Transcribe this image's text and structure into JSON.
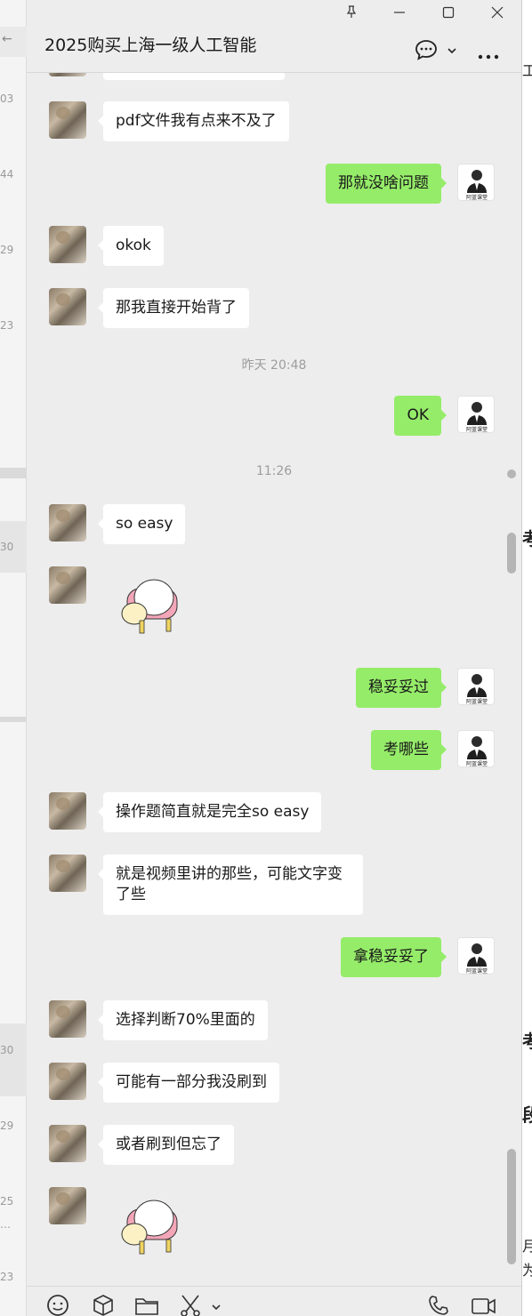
{
  "window": {
    "title": "2025购买上海一级人工智能",
    "controls": [
      "pin-icon",
      "minimize-icon",
      "maximize-icon",
      "close-icon"
    ]
  },
  "header_icons": [
    "chat-bubble-icon",
    "chevron-down-icon",
    "more-icon"
  ],
  "left_list_times": [
    "03",
    "44",
    "29",
    "23",
    "30",
    "30",
    "29",
    "25",
    "23"
  ],
  "left_list_extra": [
    "…",
    "←"
  ],
  "messages": [
    {
      "type": "text",
      "dir": "in",
      "text": "pdf文件我有点来不及了"
    },
    {
      "type": "text",
      "dir": "out",
      "text": "那就没啥问题"
    },
    {
      "type": "text",
      "dir": "in",
      "text": "okok"
    },
    {
      "type": "text",
      "dir": "in",
      "text": "那我直接开始背了"
    },
    {
      "type": "time",
      "text": "昨天 20:48"
    },
    {
      "type": "text",
      "dir": "out",
      "text": "OK"
    },
    {
      "type": "time",
      "text": "11:26"
    },
    {
      "type": "text",
      "dir": "in",
      "text": "so easy"
    },
    {
      "type": "sticker",
      "dir": "in",
      "sticker": "sitting-bunny-sticker"
    },
    {
      "type": "text",
      "dir": "out",
      "text": "稳妥妥过"
    },
    {
      "type": "text",
      "dir": "out",
      "text": "考哪些"
    },
    {
      "type": "text",
      "dir": "in",
      "text": "操作题简直就是完全so easy"
    },
    {
      "type": "text",
      "dir": "in",
      "text": "就是视频里讲的那些，可能文字变了些"
    },
    {
      "type": "text",
      "dir": "out",
      "text": "拿稳妥妥了"
    },
    {
      "type": "text",
      "dir": "in",
      "text": "选择判断70%里面的"
    },
    {
      "type": "text",
      "dir": "in",
      "text": "可能有一部分我没刷到"
    },
    {
      "type": "text",
      "dir": "in",
      "text": "或者刷到但忘了"
    },
    {
      "type": "sticker",
      "dir": "in",
      "sticker": "sitting-bunny-sticker"
    }
  ],
  "my_avatar_caption": "阿蓝课堂",
  "toolbar_icons": [
    "emoji-icon",
    "box-icon",
    "folder-icon",
    "scissors-icon",
    "chevron-down-icon",
    "phone-icon",
    "video-icon"
  ],
  "right_strip_chars": [
    "工",
    "考",
    "考",
    "段",
    "月",
    "为"
  ],
  "colors": {
    "out_bubble": "#95ec69",
    "in_bubble": "#ffffff",
    "background": "#ededed"
  }
}
